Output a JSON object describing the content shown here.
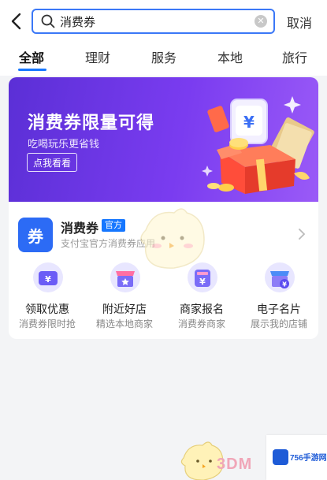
{
  "header": {
    "search_value": "消费券",
    "cancel_label": "取消"
  },
  "tabs": [
    {
      "label": "全部"
    },
    {
      "label": "理财"
    },
    {
      "label": "服务"
    },
    {
      "label": "本地"
    },
    {
      "label": "旅行"
    }
  ],
  "banner": {
    "title": "消费券限量可得",
    "subtitle": "吃喝玩乐更省钱",
    "button_label": "点我看看",
    "gift_tag": "¥"
  },
  "app": {
    "icon_char": "券",
    "name": "消费券",
    "badge": "官方",
    "description": "支付宝官方消费券应用"
  },
  "services": [
    {
      "label": "领取优惠",
      "sub": "消费券限时抢",
      "icon": "coupon-icon"
    },
    {
      "label": "附近好店",
      "sub": "精选本地商家",
      "icon": "store-icon"
    },
    {
      "label": "商家报名",
      "sub": "消费券商家",
      "icon": "merchant-coupon-icon"
    },
    {
      "label": "电子名片",
      "sub": "展示我的店铺",
      "icon": "business-card-icon"
    }
  ],
  "watermark": {
    "text": "3DM",
    "site": "756手游网"
  },
  "colors": {
    "accent": "#1677ff",
    "banner": "#7a3cf0",
    "app_icon": "#2c6bf5"
  }
}
